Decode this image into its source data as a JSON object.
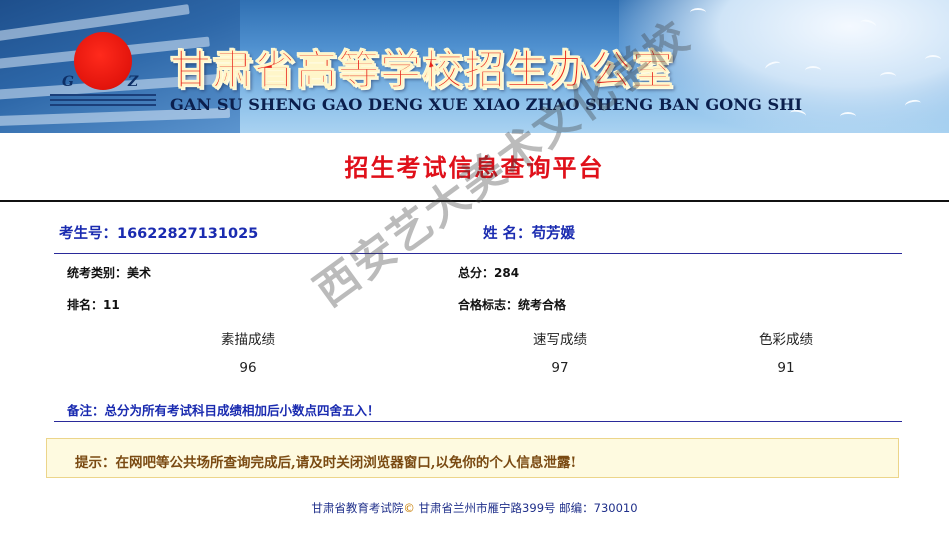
{
  "banner": {
    "title_cn": "甘肃省高等学校招生办公室",
    "title_en": "GAN SU SHENG GAO DENG XUE XIAO ZHAO SHENG BAN GONG SHI",
    "logo_letters": [
      "G",
      "Z"
    ]
  },
  "platform_title": "招生考试信息查询平台",
  "student": {
    "id_label": "考生号：",
    "id_value": "16622827131025",
    "name_label": "姓  名：",
    "name_value": "苟芳媛"
  },
  "details": {
    "category": "统考类别：美术",
    "total": "总分：284",
    "rank": "排名：11",
    "qualified": "合格标志：统考合格"
  },
  "scores": [
    {
      "subject": "素描成绩",
      "value": "96"
    },
    {
      "subject": "速写成绩",
      "value": "97"
    },
    {
      "subject": "色彩成绩",
      "value": "91"
    }
  ],
  "note": "备注：总分为所有考试科目成绩相加后小数点四舍五入！",
  "tip": "提示：在网吧等公共场所查询完成后,请及时关闭浏览器窗口,以免你的个人信息泄露!",
  "footer": {
    "org": "甘肃省教育考试院",
    "copy": "©",
    "address": " 甘肃省兰州市雁宁路399号 邮编：730010"
  },
  "watermark": "西安艺大美术文化学校",
  "colors": {
    "banner_title": "#e8231a",
    "platform_title": "#e0101a",
    "link_blue": "#1a2bb0",
    "tip_bg": "#fefae0"
  }
}
